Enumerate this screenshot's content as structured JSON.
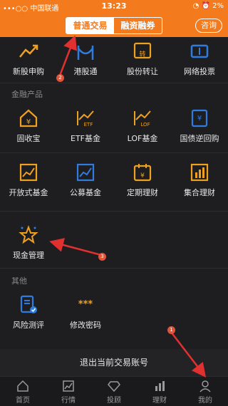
{
  "status": {
    "carrier": "•••○○ 中国联通",
    "time": "13:23",
    "right": "◔ ⏰ 2%"
  },
  "header": {
    "tab_active": "普通交易",
    "tab_inactive": "融资融券",
    "consult": "咨询"
  },
  "row1": [
    "新股申购",
    "港股通",
    "股份转让",
    "网络投票"
  ],
  "section_finance": "金融产品",
  "row2": [
    "固收宝",
    "ETF基金",
    "LOF基金",
    "国债逆回购"
  ],
  "row3": [
    "开放式基金",
    "公募基金",
    "定期理财",
    "集合理财"
  ],
  "row4": [
    "现金管理"
  ],
  "section_other": "其他",
  "row5": [
    "风险测评",
    "修改密码"
  ],
  "logout": "退出当前交易账号",
  "tabs": [
    "首页",
    "行情",
    "投顾",
    "理财",
    "我的"
  ],
  "badges": [
    "2",
    "3",
    "1"
  ],
  "icons": {
    "row5_password": "***"
  },
  "colors": {
    "accent": "#f37b1d",
    "icon_orange": "#f0a020",
    "icon_blue": "#2f7ce0",
    "annotation": "#e03030"
  }
}
